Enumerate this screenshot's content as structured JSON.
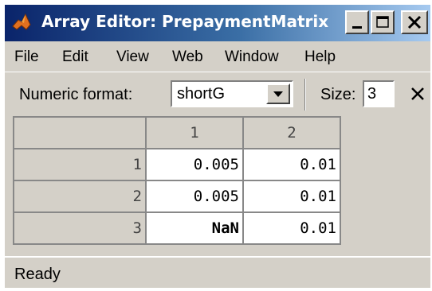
{
  "window": {
    "title": "Array Editor: PrepaymentMatrix",
    "controls": {
      "minimize": "_",
      "maximize": "□",
      "close": "×"
    }
  },
  "menu": {
    "items": [
      {
        "label": "File"
      },
      {
        "label": "Edit"
      },
      {
        "label": "View"
      },
      {
        "label": "Web"
      },
      {
        "label": "Window"
      },
      {
        "label": "Help"
      }
    ]
  },
  "toolbar": {
    "numeric_format_label": "Numeric format:",
    "numeric_format_value": "shortG",
    "size_label": "Size:",
    "size_value": "3",
    "close_icon": "close-icon"
  },
  "grid": {
    "column_headers": [
      "1",
      "2"
    ],
    "rows": [
      {
        "header": "1",
        "cells": [
          "0.005",
          "0.01"
        ]
      },
      {
        "header": "2",
        "cells": [
          "0.005",
          "0.01"
        ]
      },
      {
        "header": "3",
        "cells": [
          "NaN",
          "0.01"
        ]
      }
    ]
  },
  "status": {
    "text": "Ready"
  },
  "colors": {
    "title_gradient_start": "#0a246a",
    "title_gradient_end": "#a6caf0",
    "window_face": "#d4d0c8",
    "cell_background": "#ffffff"
  }
}
